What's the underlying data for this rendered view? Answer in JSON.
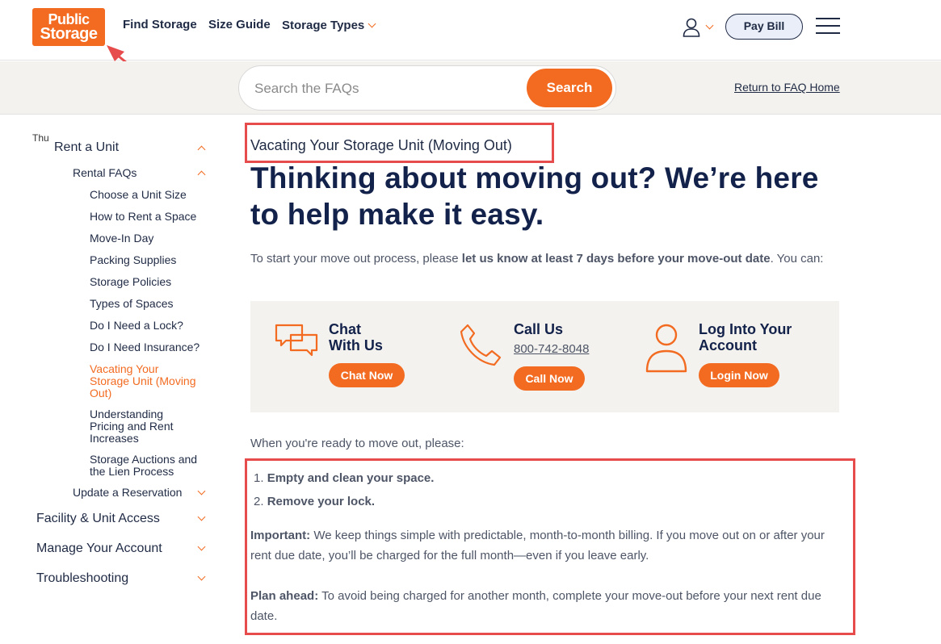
{
  "header": {
    "logo_line1": "Public",
    "logo_line2": "Storage",
    "nav": {
      "find": "Find Storage",
      "size": "Size Guide",
      "types": "Storage Types"
    },
    "pay_bill": "Pay Bill"
  },
  "search": {
    "placeholder": "Search the FAQs",
    "button": "Search",
    "return_link": "Return to FAQ Home"
  },
  "sidebar": {
    "broken_image_alt": "Thu",
    "rent_a_unit": "Rent a Unit",
    "rental_faqs": "Rental FAQs",
    "items": [
      "Choose a Unit Size",
      "How to Rent a Space",
      "Move-In Day",
      "Packing Supplies",
      "Storage Policies",
      "Types of Spaces",
      "Do I Need a Lock?",
      "Do I Need Insurance?"
    ],
    "active_lines": [
      "Vacating Your",
      "Storage Unit (Moving",
      "Out)"
    ],
    "pricing_lines": [
      "Understanding",
      "Pricing and Rent",
      "Increases"
    ],
    "auction_lines": [
      "Storage Auctions and",
      "the Lien Process"
    ],
    "update_reservation": "Update a Reservation",
    "facility_access": "Facility & Unit Access",
    "manage_account": "Manage Your Account",
    "troubleshooting": "Troubleshooting"
  },
  "main": {
    "subtitle": "Vacating Your Storage Unit (Moving Out)",
    "headline_line1": "Thinking about moving out? We’re here",
    "headline_line2": "to help make it easy.",
    "intro_start": "To start your move out process, please ",
    "intro_bold": "let us know at least 7 days before your move-out date",
    "intro_end": ". You can:",
    "contact": {
      "chat_title_1": "Chat",
      "chat_title_2": "With Us",
      "chat_button": "Chat Now",
      "call_title": "Call Us",
      "call_phone": "800-742-8048",
      "call_button": "Call Now",
      "login_title_1": "Log Into Your",
      "login_title_2": "Account",
      "login_button": "Login Now"
    },
    "ready": "When you're ready to move out, please:",
    "step1_num": "1.",
    "step1": "Empty and clean your space.",
    "step2_num": "2.",
    "step2": "Remove your lock.",
    "important_label": "Important:",
    "important_text": " We keep things simple with predictable, month-to-month billing. If you move out on or after your rent due date, you’ll be charged for the full month—even if you leave early.",
    "plan_label": "Plan ahead:",
    "plan_text": " To avoid being charged for another month, complete your move-out before your next rent due date."
  },
  "colors": {
    "brand_orange": "#f26b21",
    "navy": "#13224a",
    "annotation_red": "#e74c4c"
  }
}
